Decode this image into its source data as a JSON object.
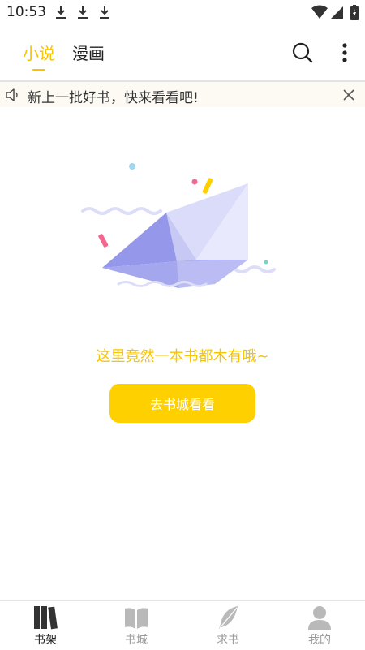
{
  "status_bar": {
    "time": "10:53",
    "download_icons": [
      "download-icon",
      "download-icon",
      "download-icon"
    ],
    "system_icons": [
      "wifi-icon",
      "signal-icon",
      "battery-icon"
    ]
  },
  "header": {
    "tabs": [
      {
        "label": "小说",
        "active": true
      },
      {
        "label": "漫画",
        "active": false
      }
    ],
    "actions": [
      "search-icon",
      "more-vertical-icon"
    ],
    "accent_color": "#f6c400"
  },
  "notice": {
    "icon": "speaker-icon",
    "text": "新上一批好书，快来看看吧!",
    "close_icon": "close-icon"
  },
  "empty_state": {
    "illustration": "paper-boat-illustration",
    "message": "这里竟然一本书都木有哦~",
    "button_label": "去书城看看",
    "button_color": "#ffd000"
  },
  "bottom_nav": {
    "items": [
      {
        "label": "书架",
        "icon": "bookshelf-icon",
        "active": true
      },
      {
        "label": "书城",
        "icon": "book-open-icon",
        "active": false
      },
      {
        "label": "求书",
        "icon": "feather-icon",
        "active": false
      },
      {
        "label": "我的",
        "icon": "user-icon",
        "active": false
      }
    ]
  }
}
